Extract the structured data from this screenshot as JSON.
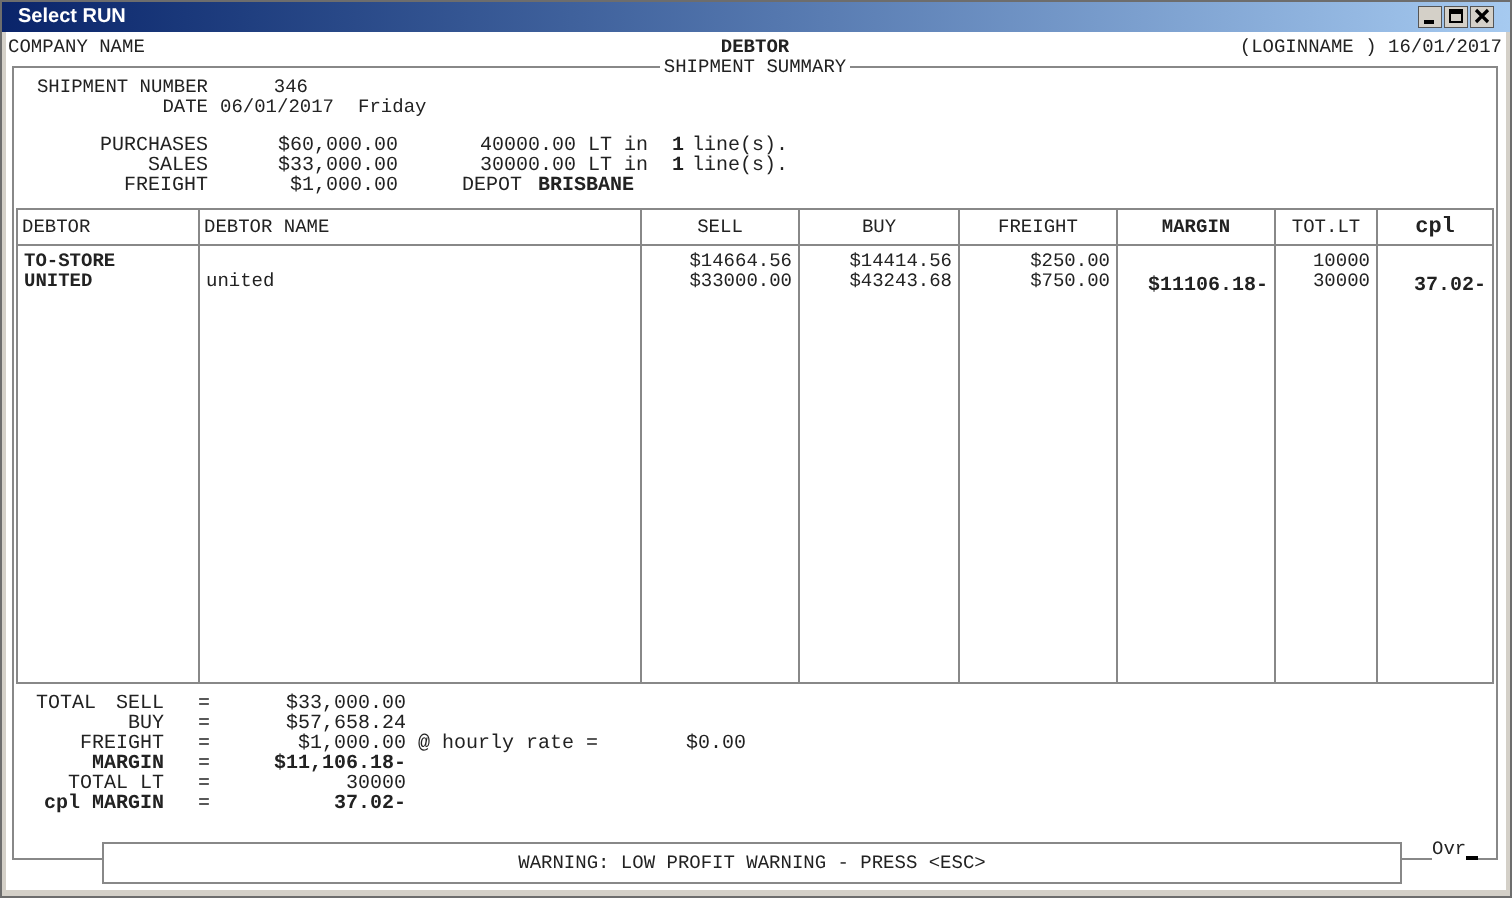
{
  "window": {
    "title": "Select RUN"
  },
  "header": {
    "company": "COMPANY NAME",
    "title": "DEBTOR",
    "user_date": "(LOGINNAME ) 16/01/2017"
  },
  "summary": {
    "caption": "SHIPMENT SUMMARY",
    "shipment": {
      "label": "SHIPMENT NUMBER",
      "value": "346"
    },
    "date": {
      "label": "DATE",
      "value": "06/01/2017",
      "day": "Friday"
    },
    "lines": [
      {
        "label": "PURCHASES",
        "amount": "$60,000.00",
        "litres": "40000.00 LT in",
        "count": "1",
        "unit": "line(s)."
      },
      {
        "label": "SALES",
        "amount": "$33,000.00",
        "litres": "30000.00 LT in",
        "count": "1",
        "unit": "line(s)."
      }
    ],
    "freight": {
      "label": "FREIGHT",
      "amount": "$1,000.00",
      "depot_label": "DEPOT",
      "depot": "BRISBANE"
    }
  },
  "table": {
    "columns": [
      {
        "label": "DEBTOR",
        "bold": false
      },
      {
        "label": "DEBTOR NAME",
        "bold": false
      },
      {
        "label": "SELL",
        "bold": false
      },
      {
        "label": "BUY",
        "bold": false
      },
      {
        "label": "FREIGHT",
        "bold": false
      },
      {
        "label": "MARGIN",
        "bold": true
      },
      {
        "label": "TOT.LT",
        "bold": false
      },
      {
        "label": "cpl",
        "bold": true
      }
    ],
    "rows": [
      [
        "TO-STORE",
        null,
        "$14664.56",
        "$14414.56",
        "$250.00",
        null,
        "10000",
        null
      ],
      [
        "UNITED",
        "united",
        "$33000.00",
        "$43243.68",
        "$750.00",
        "$11106.18-",
        "30000",
        "37.02-"
      ]
    ]
  },
  "totals": {
    "prefix": "TOTAL",
    "lines": [
      {
        "label": "SELL",
        "equals": "=",
        "value": "$33,000.00",
        "bold": false
      },
      {
        "label": "BUY",
        "equals": "=",
        "value": "$57,658.24",
        "bold": false
      },
      {
        "label": "FREIGHT",
        "equals": "=",
        "value": "$1,000.00",
        "bold": false,
        "note": "@ hourly rate =",
        "note_value": "$0.00"
      },
      {
        "label": "MARGIN",
        "equals": "=",
        "value": "$11,106.18-",
        "bold": true
      },
      {
        "label": "TOTAL LT",
        "equals": "=",
        "value": "30000",
        "bold": false
      },
      {
        "label": "cpl MARGIN",
        "equals": "=",
        "value": "37.02-",
        "bold": true
      }
    ]
  },
  "message": "WARNING: LOW PROFIT WARNING - PRESS <ESC>",
  "mode": "Ovr"
}
